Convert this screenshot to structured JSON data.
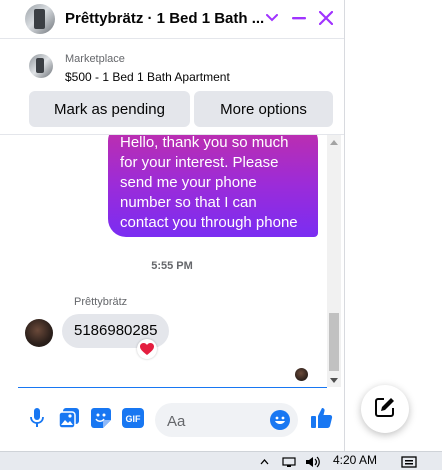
{
  "header": {
    "title": "Prêttybrätz · 1 Bed 1 Bath ...",
    "accent_color": "#a033ff"
  },
  "listing": {
    "source": "Marketplace",
    "name": "$500 - 1 Bed 1 Bath Apartment",
    "pending_button": "Mark as pending",
    "more_button": "More options"
  },
  "messages": {
    "outgoing_text": "Hello, thank you so much for your interest. Please send me your phone number so that I can contact you through phone",
    "timestamp": "5:55 PM",
    "sender_name": "Prêttybrätz",
    "incoming_text": "5186980285",
    "reaction": "heart"
  },
  "composer": {
    "placeholder": "Aa",
    "value": ""
  },
  "taskbar": {
    "time": "4:20 AM"
  },
  "icons": {
    "header": [
      "chevron-down-icon",
      "minimize-icon",
      "close-icon"
    ],
    "composer": [
      "microphone-icon",
      "image-icon",
      "sticker-icon",
      "gif-icon",
      "emoji-icon",
      "like-icon"
    ],
    "floating": "new-message-icon"
  }
}
